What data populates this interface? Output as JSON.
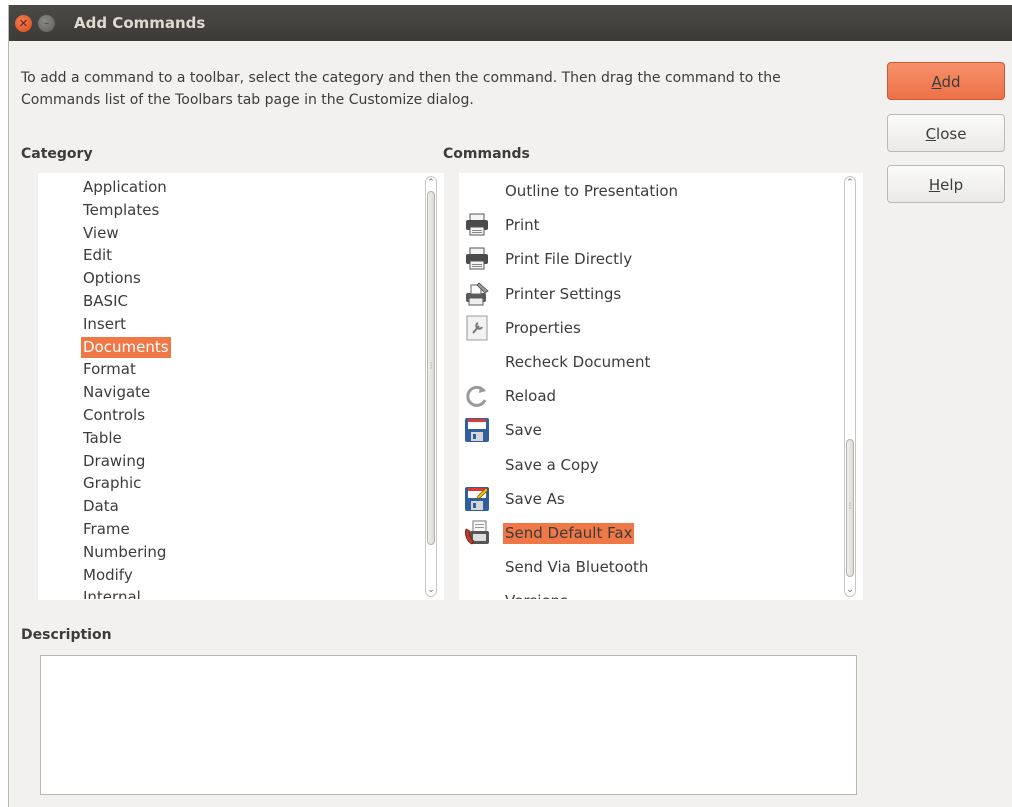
{
  "window": {
    "title": "Add Commands"
  },
  "intro_text": "To add a command to a toolbar, select the category and then the command. Then drag the command to the Commands list of the Toolbars tab page in the Customize dialog.",
  "category": {
    "label": "Category",
    "items": [
      "Application",
      "Templates",
      "View",
      "Edit",
      "Options",
      "BASIC",
      "Insert",
      "Documents",
      "Format",
      "Navigate",
      "Controls",
      "Table",
      "Drawing",
      "Graphic",
      "Data",
      "Frame",
      "Numbering",
      "Modify",
      "Internal"
    ],
    "selected": "Documents"
  },
  "commands": {
    "label": "Commands",
    "items": [
      {
        "label": "Outline to Presentation",
        "icon": "none"
      },
      {
        "label": "Print",
        "icon": "printer-icon"
      },
      {
        "label": "Print File Directly",
        "icon": "printer-icon"
      },
      {
        "label": "Printer Settings",
        "icon": "printer-settings-icon"
      },
      {
        "label": "Properties",
        "icon": "properties-icon"
      },
      {
        "label": "Recheck Document",
        "icon": "none"
      },
      {
        "label": "Reload",
        "icon": "reload-icon"
      },
      {
        "label": "Save",
        "icon": "save-icon"
      },
      {
        "label": "Save a Copy",
        "icon": "none"
      },
      {
        "label": "Save As",
        "icon": "save-as-icon"
      },
      {
        "label": "Send Default Fax",
        "icon": "fax-icon"
      },
      {
        "label": "Send Via Bluetooth",
        "icon": "none"
      },
      {
        "label": "Versions",
        "icon": "none"
      }
    ],
    "selected": "Send Default Fax"
  },
  "description": {
    "label": "Description",
    "text": ""
  },
  "buttons": {
    "add": {
      "pre": "",
      "mnemonic": "A",
      "post": "dd"
    },
    "close": {
      "pre": "",
      "mnemonic": "C",
      "post": "lose"
    },
    "help": {
      "pre": "",
      "mnemonic": "H",
      "post": "elp"
    }
  },
  "colors": {
    "selection": "#f07746",
    "titlebar": "#3c3b37",
    "primary_button": "#ed7148"
  }
}
